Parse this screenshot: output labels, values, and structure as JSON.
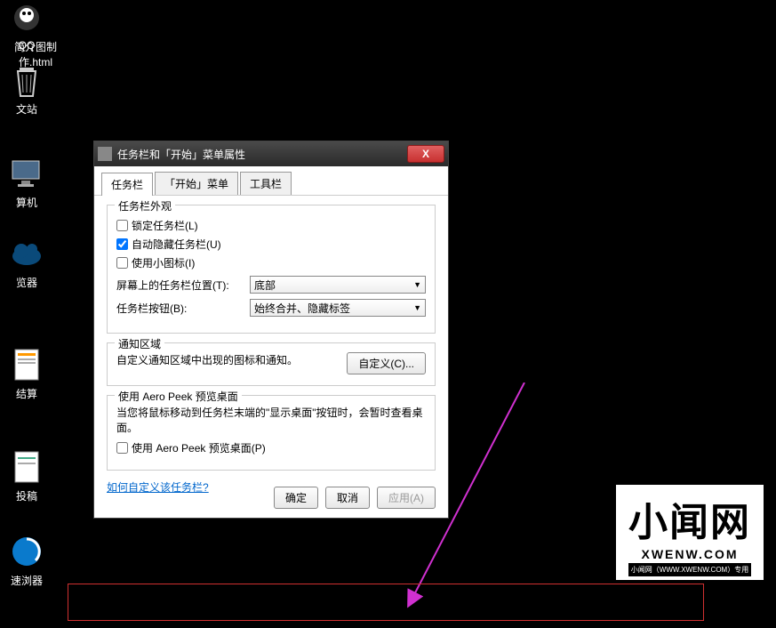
{
  "desktop": {
    "icons": [
      {
        "label": "QQ"
      },
      {
        "label": "简介图制作.html"
      },
      {
        "label": "文站"
      },
      {
        "label": "算机"
      },
      {
        "label": "览器"
      },
      {
        "label": "结算"
      },
      {
        "label": "投稿"
      },
      {
        "label": "速浏器"
      }
    ]
  },
  "dialog": {
    "title": "任务栏和「开始」菜单属性",
    "close": "X",
    "tabs": {
      "t0": "任务栏",
      "t1": "「开始」菜单",
      "t2": "工具栏"
    },
    "group1": {
      "title": "任务栏外观",
      "lock": "锁定任务栏(L)",
      "autohide": "自动隐藏任务栏(U)",
      "smallicon": "使用小图标(I)",
      "pos_label": "屏幕上的任务栏位置(T):",
      "pos_value": "底部",
      "btn_label": "任务栏按钮(B):",
      "btn_value": "始终合并、隐藏标签"
    },
    "group2": {
      "title": "通知区域",
      "desc": "自定义通知区域中出现的图标和通知。",
      "custom_btn": "自定义(C)..."
    },
    "group3": {
      "title": "使用 Aero Peek 预览桌面",
      "desc": "当您将鼠标移动到任务栏末端的\"显示桌面\"按钮时，会暂时查看桌面。",
      "check": "使用 Aero Peek 预览桌面(P)"
    },
    "link": "如何自定义该任务栏?",
    "ok": "确定",
    "cancel": "取消",
    "apply": "应用(A)"
  },
  "watermark": {
    "big": "小闻网",
    "small": "XWENW.COM",
    "tiny": "小闻网（WWW.XWENW.COM）专用"
  }
}
